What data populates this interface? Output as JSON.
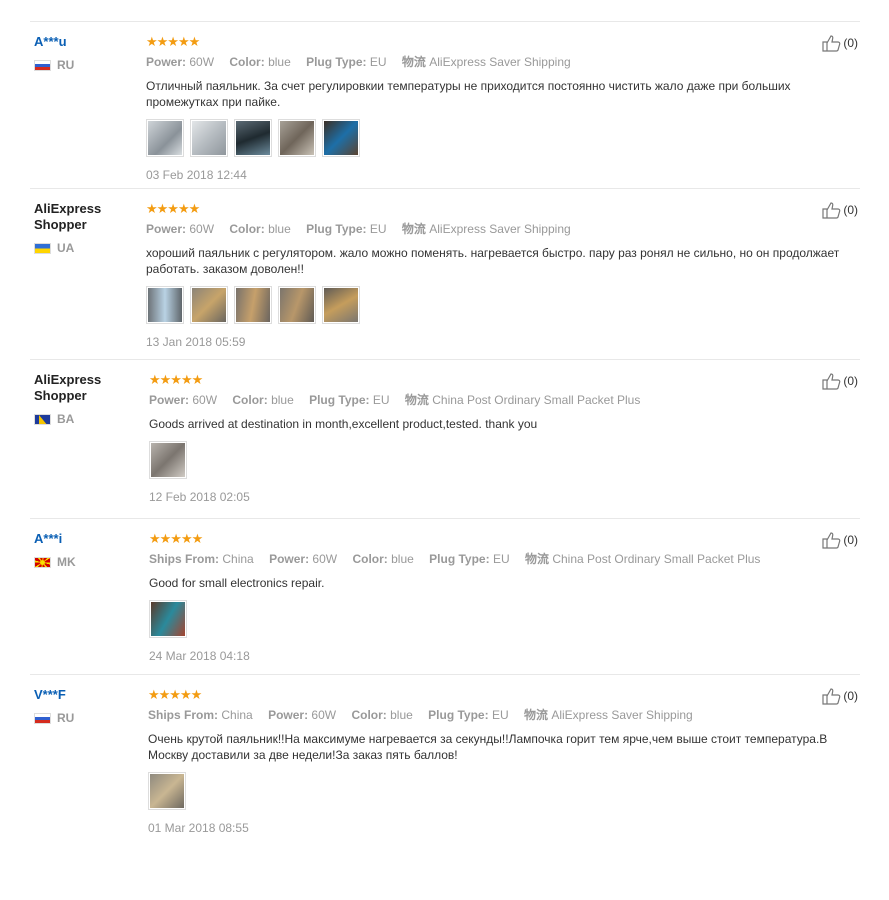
{
  "reviews": [
    {
      "user": "A***u",
      "country": "RU",
      "stars": "★★★★★",
      "attrs": [
        {
          "k": "Power:",
          "v": "60W"
        },
        {
          "k": "Color:",
          "v": "blue"
        },
        {
          "k": "Plug Type:",
          "v": "EU"
        },
        {
          "k": "物流",
          "v": "AliExpress Saver Shipping"
        }
      ],
      "text": "Отличный паяльник. За счет регулировкии температуры не приходится постоянно чистить жало даже при больших промежутках при пайке.",
      "date": "03 Feb 2018 12:44",
      "likes": "(0)"
    },
    {
      "user": "AliExpress Shopper",
      "country": "UA",
      "stars": "★★★★★",
      "attrs": [
        {
          "k": "Power:",
          "v": "60W"
        },
        {
          "k": "Color:",
          "v": "blue"
        },
        {
          "k": "Plug Type:",
          "v": "EU"
        },
        {
          "k": "物流",
          "v": "AliExpress Saver Shipping"
        }
      ],
      "text": "хороший паяльник с регулятором. жало можно поменять. нагревается быстро. пару раз ронял не сильно, но он продолжает работать. заказом доволен!!",
      "date": "13 Jan 2018 05:59",
      "likes": "(0)"
    },
    {
      "user": "AliExpress Shopper",
      "country": "BA",
      "stars": "★★★★★",
      "attrs": [
        {
          "k": "Power:",
          "v": "60W"
        },
        {
          "k": "Color:",
          "v": "blue"
        },
        {
          "k": "Plug Type:",
          "v": "EU"
        },
        {
          "k": "物流",
          "v": "China Post Ordinary Small Packet Plus"
        }
      ],
      "text": "Goods arrived at destination in month,excellent product,tested. thank you",
      "date": "12 Feb 2018 02:05",
      "likes": "(0)"
    },
    {
      "user": "A***i",
      "country": "MK",
      "stars": "★★★★★",
      "attrs": [
        {
          "k": "Ships From:",
          "v": "China"
        },
        {
          "k": "Power:",
          "v": "60W"
        },
        {
          "k": "Color:",
          "v": "blue"
        },
        {
          "k": "Plug Type:",
          "v": "EU"
        },
        {
          "k": "物流",
          "v": "China Post Ordinary Small Packet Plus"
        }
      ],
      "text": "Good for small electronics repair.",
      "date": "24 Mar 2018 04:18",
      "likes": "(0)"
    },
    {
      "user": "V***F",
      "country": "RU",
      "stars": "★★★★★",
      "attrs": [
        {
          "k": "Ships From:",
          "v": "China"
        },
        {
          "k": "Power:",
          "v": "60W"
        },
        {
          "k": "Color:",
          "v": "blue"
        },
        {
          "k": "Plug Type:",
          "v": "EU"
        },
        {
          "k": "物流",
          "v": "AliExpress Saver Shipping"
        }
      ],
      "text": "Очень крутой паяльник!!На максимуме нагревается за секунды!!Лампочка горит тем ярче,чем выше стоит температура.В Москву доставили за две недели!За заказ пять баллов!",
      "date": "01 Mar 2018 08:55",
      "likes": "(0)"
    }
  ]
}
